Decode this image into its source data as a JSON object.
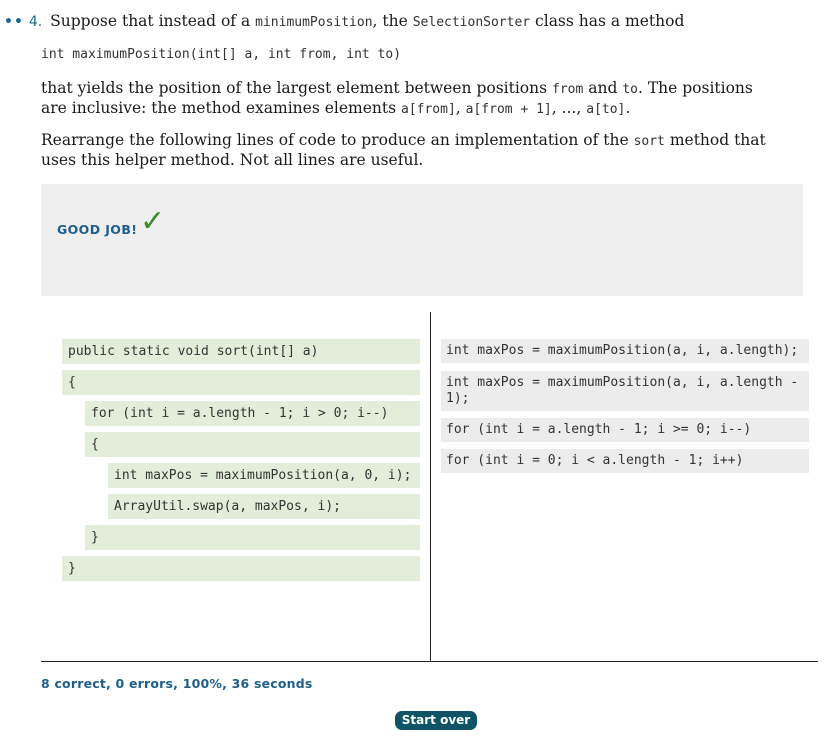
{
  "problem": {
    "dots": "••",
    "number": "4.",
    "intro_1": "Suppose that instead of a ",
    "intro_code_1": "minimumPosition",
    "intro_2": ", the ",
    "intro_code_2": "SelectionSorter",
    "intro_3": " class has a method",
    "signature": "int maximumPosition(int[] a, int from, int to)",
    "para1_a": "that yields the position of the largest element between positions ",
    "para1_code_from": "from",
    "para1_b": " and ",
    "para1_code_to": "to",
    "para1_c": ". The positions are inclusive: the method examines elements ",
    "para1_code_e1": "a[from]",
    "para1_d": ", ",
    "para1_code_e2": "a[from + 1]",
    "para1_e": ", ..., ",
    "para1_code_e3": "a[to]",
    "para1_f": ".",
    "para2_a": "Rearrange the following lines of code to produce an implementation of the ",
    "para2_code": "sort",
    "para2_b": " method that uses this helper method. Not all lines are useful."
  },
  "feedback": {
    "message": "GOOD JOB!",
    "check_icon": "✓",
    "check_color": "#3f8a2b"
  },
  "solution_lines": [
    "public static void sort(int[] a)",
    "{",
    "for (int i = a.length - 1; i > 0; i--)",
    "{",
    "int maxPos = maximumPosition(a, 0, i);",
    "ArrayUtil.swap(a, maxPos, i);",
    "}",
    "}"
  ],
  "unused_lines": [
    "int maxPos = maximumPosition(a, i, a.length);",
    "int maxPos = maximumPosition(a, i, a.length - 1);",
    "for (int i = a.length - 1; i >= 0; i--)",
    "for (int i = 0; i < a.length - 1; i++)"
  ],
  "status": "8 correct, 0 errors, 100%, 36 seconds",
  "start_over_label": "Start over"
}
